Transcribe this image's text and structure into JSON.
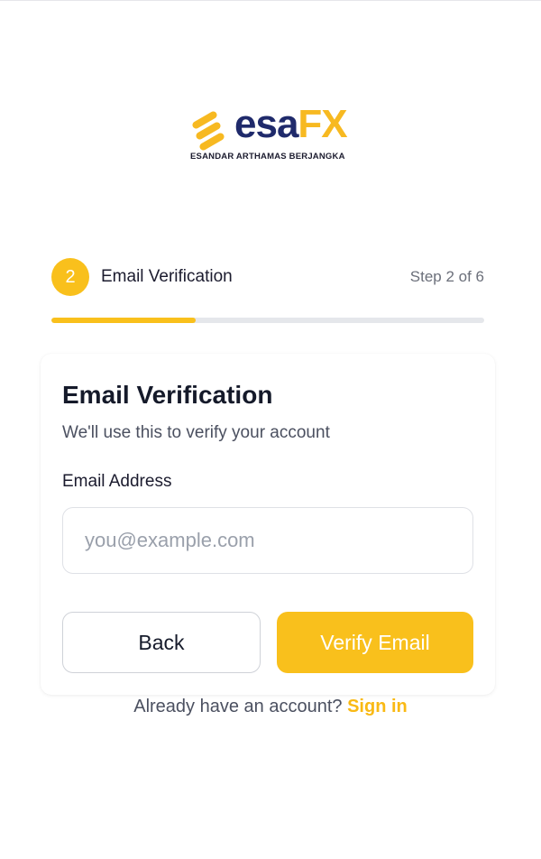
{
  "logo": {
    "word_esa": "esa",
    "word_fx": "FX",
    "tagline": "ESANDAR ARTHAMAS BERJANGKA",
    "colors": {
      "navy": "#1f2a6b",
      "gold": "#f7b921"
    }
  },
  "stepper": {
    "step_number": "2",
    "step_title": "Email Verification",
    "step_count": "Step 2 of 6",
    "progress_fraction": 0.333
  },
  "card": {
    "title": "Email Verification",
    "subtitle": "We'll use this to verify your account",
    "email_label": "Email Address",
    "email_placeholder": "you@example.com",
    "email_value": "",
    "back_label": "Back",
    "verify_label": "Verify Email"
  },
  "footer": {
    "prompt": "Already have an account?",
    "signin_label": "Sign in"
  },
  "colors": {
    "accent": "#f9c01c",
    "text_dark": "#151a2a",
    "text_muted": "#4b5060"
  }
}
